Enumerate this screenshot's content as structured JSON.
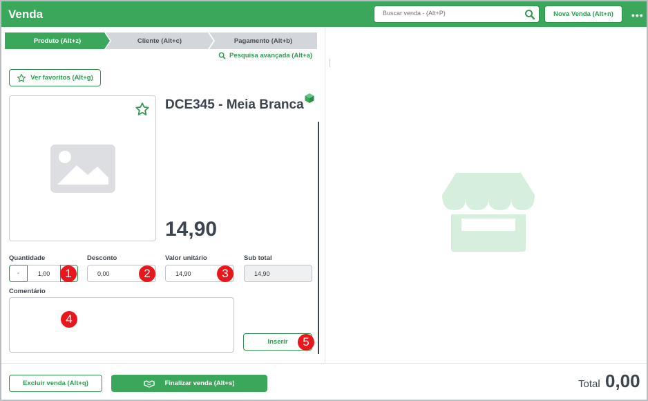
{
  "header": {
    "title": "Venda",
    "search_placeholder": "Buscar venda - (Alt+P)",
    "new_sale_label": "Nova Venda  (Alt+n)",
    "more_label": "•••"
  },
  "steps": [
    {
      "label": "Produto (Alt+z)",
      "active": true
    },
    {
      "label": "Cliente (Alt+c)",
      "active": false
    },
    {
      "label": "Pagamento (Alt+b)",
      "active": false
    }
  ],
  "product_panel": {
    "advanced_search_label": "Pesquisa avançada (Alt+a)",
    "favorites_label": "Ver favoritos (Alt+g)",
    "product_title": "DCE345 - Meia Branca",
    "product_price": "14,90"
  },
  "form": {
    "quantity_label": "Quantidade",
    "quantity_minus": "-",
    "quantity_value": "1,00",
    "discount_label": "Desconto",
    "discount_value": "0,00",
    "unit_price_label": "Valor unitário",
    "unit_price_value": "14,90",
    "subtotal_label": "Sub total",
    "subtotal_value": "14,90",
    "comment_label": "Comentário",
    "comment_value": "",
    "insert_label": "Inserir"
  },
  "badges": [
    "1",
    "2",
    "3",
    "4",
    "5"
  ],
  "footer": {
    "delete_label": "Excluir venda (Alt+q)",
    "finalize_label": "Finalizar venda (Alt+s)",
    "total_label": "Total",
    "total_value": "0,00"
  },
  "colors": {
    "brand_green": "#3aa75b",
    "badge_red": "#e8171c",
    "placeholder_gray": "#dcdee1",
    "store_light_green": "#d6efdd"
  },
  "icons": [
    "search-icon",
    "star-icon",
    "image-placeholder-icon",
    "cube-icon",
    "store-icon",
    "handshake-icon",
    "more-icon"
  ]
}
